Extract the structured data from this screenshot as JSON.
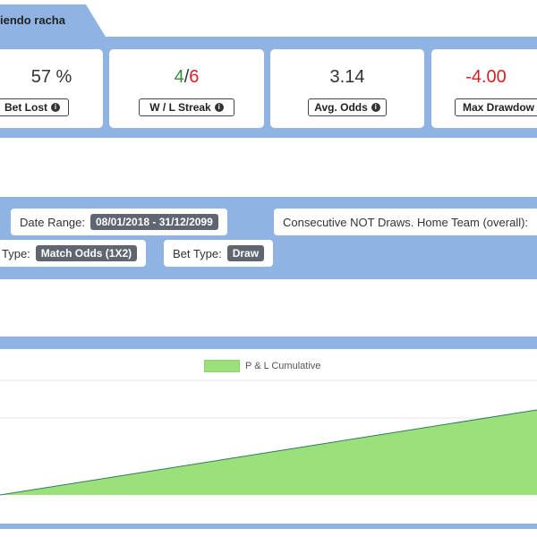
{
  "tab": {
    "label": "iendo racha"
  },
  "stats": [
    {
      "value": "57 %",
      "label": "Bet Lost",
      "color": "#333333"
    },
    {
      "value_win": "4",
      "value_sep": "/",
      "value_loss": "6",
      "label": "W / L Streak"
    },
    {
      "value": "3.14",
      "label": "Avg. Odds",
      "color": "#333333"
    },
    {
      "value": "-4.00",
      "label": "Max Drawdow",
      "color": "#d0232a"
    }
  ],
  "filters": {
    "date_range_label": "Date Range:",
    "date_range_value": "08/01/2018 - 31/12/2099",
    "strategy_text": "Consecutive NOT Draws. Home Team (overall):",
    "market_label": "Type:",
    "market_value": "Match Odds (1X2)",
    "bet_type_label": "Bet Type:",
    "bet_type_value": "Draw"
  },
  "colors": {
    "band": "#8fb4e3",
    "win": "#3b8a3b",
    "loss": "#d0232a",
    "area_fill": "#9be07a",
    "area_line": "#2e7d5b"
  },
  "chart_data": {
    "type": "area",
    "series": [
      {
        "name": "P & L Cumulative",
        "values": [
          -0.8,
          0.0
        ]
      }
    ],
    "legend": "top-center"
  }
}
